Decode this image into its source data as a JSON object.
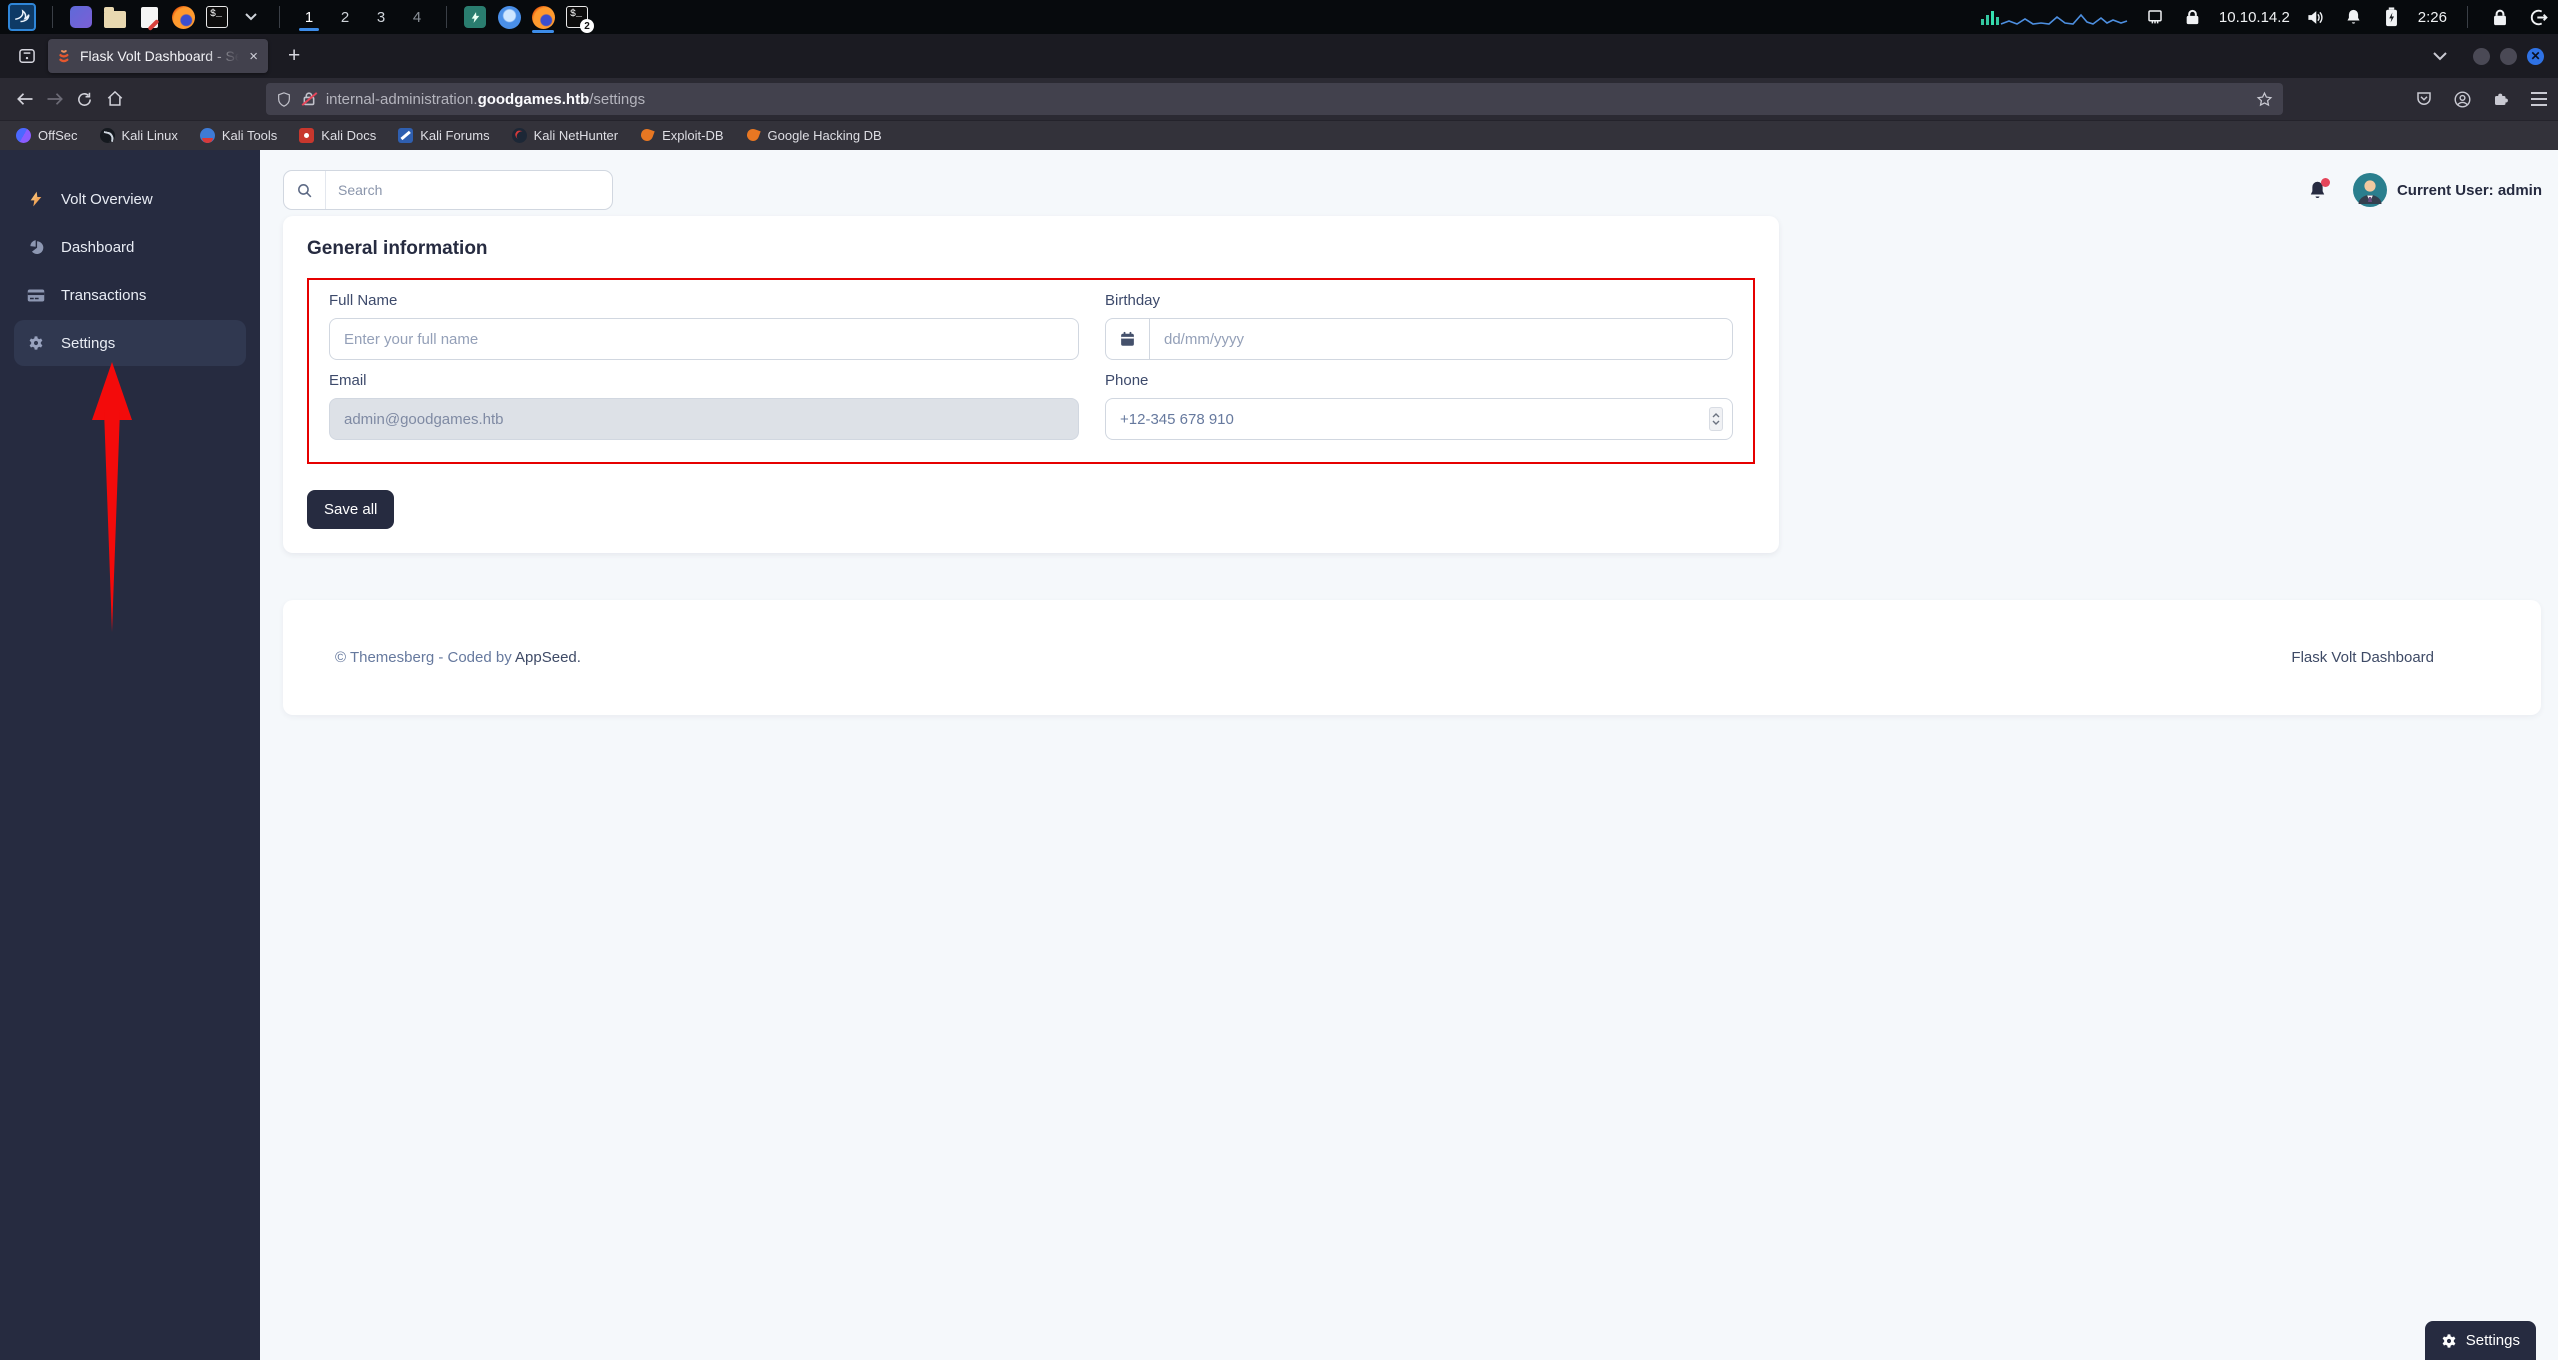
{
  "taskbar": {
    "launcher_icons": [
      "kali-menu-icon",
      "file-manager-icon",
      "folder-icon",
      "text-editor-icon",
      "firefox-icon",
      "terminal-icon",
      "chevron-down-icon"
    ],
    "workspaces": [
      "1",
      "2",
      "3",
      "4"
    ],
    "active_workspace": "1",
    "running_icons": [
      "power-app-icon",
      "chromium-icon",
      "firefox-icon",
      "terminal-icon"
    ],
    "terminal_badge": "2",
    "ip_address": "10.10.14.2",
    "clock": "2:26"
  },
  "browser": {
    "tab": {
      "title": "Flask Volt Dashboard - Se",
      "favicon": "volt-logo-icon"
    },
    "new_tab_label": "+",
    "close_tab_label": "×",
    "url": {
      "prefix": "internal-administration.",
      "domain": "goodgames.htb",
      "path": "/settings"
    },
    "bookmarks": [
      {
        "label": "OffSec",
        "icon": "offsec-icon"
      },
      {
        "label": "Kali Linux",
        "icon": "kali-linux-icon"
      },
      {
        "label": "Kali Tools",
        "icon": "kali-tools-icon"
      },
      {
        "label": "Kali Docs",
        "icon": "kali-docs-icon"
      },
      {
        "label": "Kali Forums",
        "icon": "kali-forums-icon"
      },
      {
        "label": "Kali NetHunter",
        "icon": "kali-nethunter-icon"
      },
      {
        "label": "Exploit-DB",
        "icon": "exploit-db-icon"
      },
      {
        "label": "Google Hacking DB",
        "icon": "google-hacking-db-icon"
      }
    ]
  },
  "sidebar": {
    "items": [
      {
        "label": "Volt Overview",
        "icon": "bolt-icon",
        "active": false
      },
      {
        "label": "Dashboard",
        "icon": "pie-chart-icon",
        "active": false
      },
      {
        "label": "Transactions",
        "icon": "credit-card-icon",
        "active": false
      },
      {
        "label": "Settings",
        "icon": "gear-icon",
        "active": true
      }
    ],
    "annotation": "red-arrow pointing at Settings"
  },
  "topnav": {
    "search_placeholder": "Search",
    "current_user": "Current User: admin"
  },
  "form": {
    "title": "General information",
    "fields": {
      "full_name": {
        "label": "Full Name",
        "placeholder": "Enter your full name"
      },
      "birthday": {
        "label": "Birthday",
        "placeholder": "dd/mm/yyyy",
        "icon": "calendar-icon"
      },
      "email": {
        "label": "Email",
        "value": "admin@goodgames.htb",
        "disabled": true
      },
      "phone": {
        "label": "Phone",
        "value": "+12-345 678 910"
      }
    },
    "save_label": "Save all"
  },
  "footer": {
    "copyright_prefix": "© Themesberg - Coded by ",
    "copyright_link": "AppSeed.",
    "brand": "Flask Volt Dashboard"
  },
  "floating": {
    "settings_label": "Settings"
  },
  "colors": {
    "sidebar": "#262b40",
    "page_bg": "#f5f8fb",
    "annotation_red": "#e60000",
    "accent_blue": "#3d8ce8"
  }
}
